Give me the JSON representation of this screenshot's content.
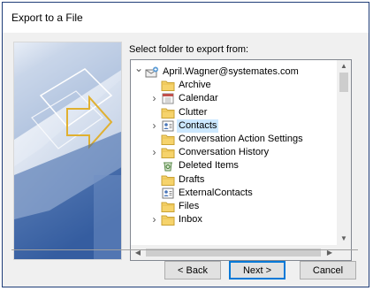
{
  "dialog": {
    "title": "Export to a File"
  },
  "prompt": "Select folder to export from:",
  "tree": {
    "items": [
      {
        "label": "April.Wagner@systemates.com",
        "icon": "mailbox-icon",
        "expander": "expanded",
        "level": 0
      },
      {
        "label": "Archive",
        "icon": "folder-icon",
        "expander": "none",
        "level": 1
      },
      {
        "label": "Calendar",
        "icon": "calendar-icon",
        "expander": "collapsed",
        "level": 1
      },
      {
        "label": "Clutter",
        "icon": "folder-icon",
        "expander": "none",
        "level": 1
      },
      {
        "label": "Contacts",
        "icon": "contacts-icon",
        "expander": "collapsed",
        "level": 1,
        "selected": true
      },
      {
        "label": "Conversation Action Settings",
        "icon": "folder-icon",
        "expander": "none",
        "level": 1
      },
      {
        "label": "Conversation History",
        "icon": "folder-icon",
        "expander": "collapsed",
        "level": 1
      },
      {
        "label": "Deleted Items",
        "icon": "deleted-items-icon",
        "expander": "none",
        "level": 1
      },
      {
        "label": "Drafts",
        "icon": "folder-icon",
        "expander": "none",
        "level": 1
      },
      {
        "label": "ExternalContacts",
        "icon": "contacts-icon",
        "expander": "none",
        "level": 1
      },
      {
        "label": "Files",
        "icon": "folder-icon",
        "expander": "none",
        "level": 1
      },
      {
        "label": "Inbox",
        "icon": "folder-icon",
        "expander": "collapsed",
        "level": 1
      }
    ]
  },
  "buttons": {
    "back": "< Back",
    "next": "Next >",
    "cancel": "Cancel"
  },
  "colors": {
    "selection": "#cce8ff",
    "folder": "#f6d36b",
    "default_button_border": "#0078d7"
  }
}
